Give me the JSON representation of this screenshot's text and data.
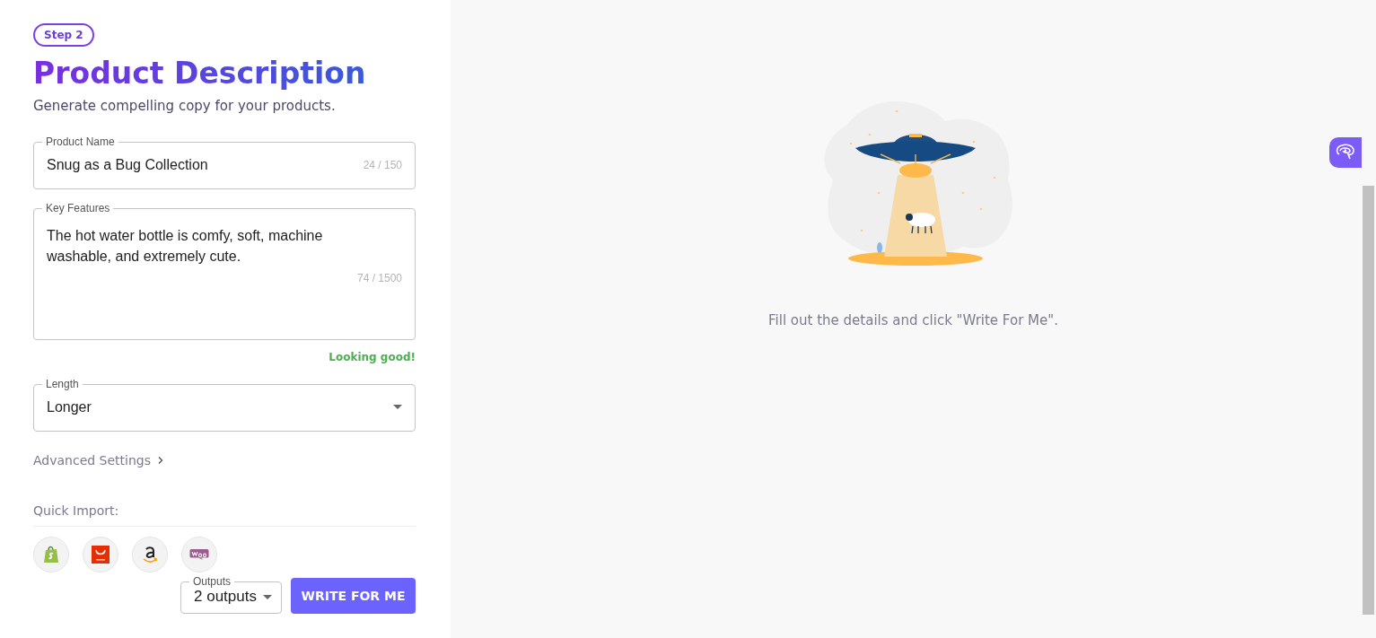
{
  "step_badge": "Step 2",
  "title": "Product Description",
  "subtitle": "Generate compelling copy for your products.",
  "fields": [
    {
      "kind": "text",
      "label": "Product Name",
      "value": "Snug as a Bug Collection",
      "counter": "24 / 150"
    },
    {
      "kind": "textarea",
      "label": "Key Features",
      "value": "The hot water bottle is comfy, soft, machine washable, and extremely cute.",
      "counter": "74 / 1500",
      "hint": "Looking good!"
    },
    {
      "kind": "select",
      "label": "Length",
      "value": "Longer"
    }
  ],
  "advanced_settings": {
    "label": "Advanced Settings",
    "expanded": false
  },
  "quick_import": {
    "label": "Quick Import:",
    "sources": [
      {
        "kind": "shopify"
      },
      {
        "kind": "aliexpress"
      },
      {
        "kind": "amazon"
      },
      {
        "kind": "woocommerce"
      }
    ]
  },
  "outputs": {
    "label": "Outputs",
    "value": "2 outputs"
  },
  "write_button": "WRITE FOR ME",
  "empty_state": {
    "message": "Fill out the details and click \"Write For Me\"."
  }
}
